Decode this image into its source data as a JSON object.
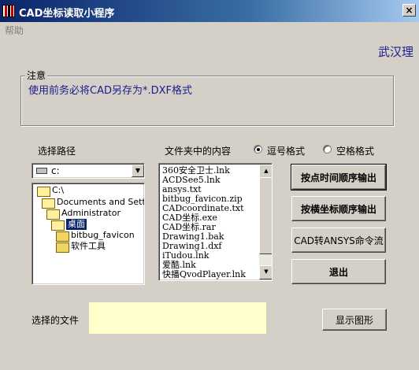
{
  "window": {
    "title": "CAD坐标读取小程序",
    "close_glyph": "×"
  },
  "menu": {
    "help": "帮助"
  },
  "org_text": "武汉理",
  "note": {
    "label": "注意",
    "text": "使用前务必将CAD另存为*.DXF格式"
  },
  "labels": {
    "path": "选择路径",
    "files": "文件夹中的内容",
    "selected_file": "选择的文件"
  },
  "format": {
    "comma": "逗号格式",
    "space": "空格格式",
    "selected": "comma"
  },
  "drive": {
    "value": "c:"
  },
  "dirs": [
    {
      "label": "C:\\",
      "open": true
    },
    {
      "label": "Documents and Setti",
      "open": true
    },
    {
      "label": "Administrator",
      "open": true
    },
    {
      "label": "桌面",
      "open": true,
      "selected": true
    },
    {
      "label": "bitbug_favicon",
      "open": false
    },
    {
      "label": "软件工具",
      "open": false
    }
  ],
  "files": [
    "360安全卫士.lnk",
    "ACDSee5.lnk",
    "ansys.txt",
    "bitbug_favicon.zip",
    "CADcoordinate.txt",
    "CAD坐标.exe",
    "CAD坐标.rar",
    "Drawing1.bak",
    "Drawing1.dxf",
    "iTudou.lnk",
    "爱酷.lnk",
    "快播QvodPlayer.lnk"
  ],
  "buttons": {
    "time_order": "按点时间顺序输出",
    "coord_order": "按横坐标顺序输出",
    "ansys": "CAD转ANSYS命令流",
    "exit": "退出",
    "show": "显示图形"
  },
  "selected_file_value": "",
  "colors": {
    "title_start": "#0a246a",
    "title_end": "#a6caf0",
    "accent_text": "#1c1c8c",
    "file_box": "#ffffcc"
  }
}
